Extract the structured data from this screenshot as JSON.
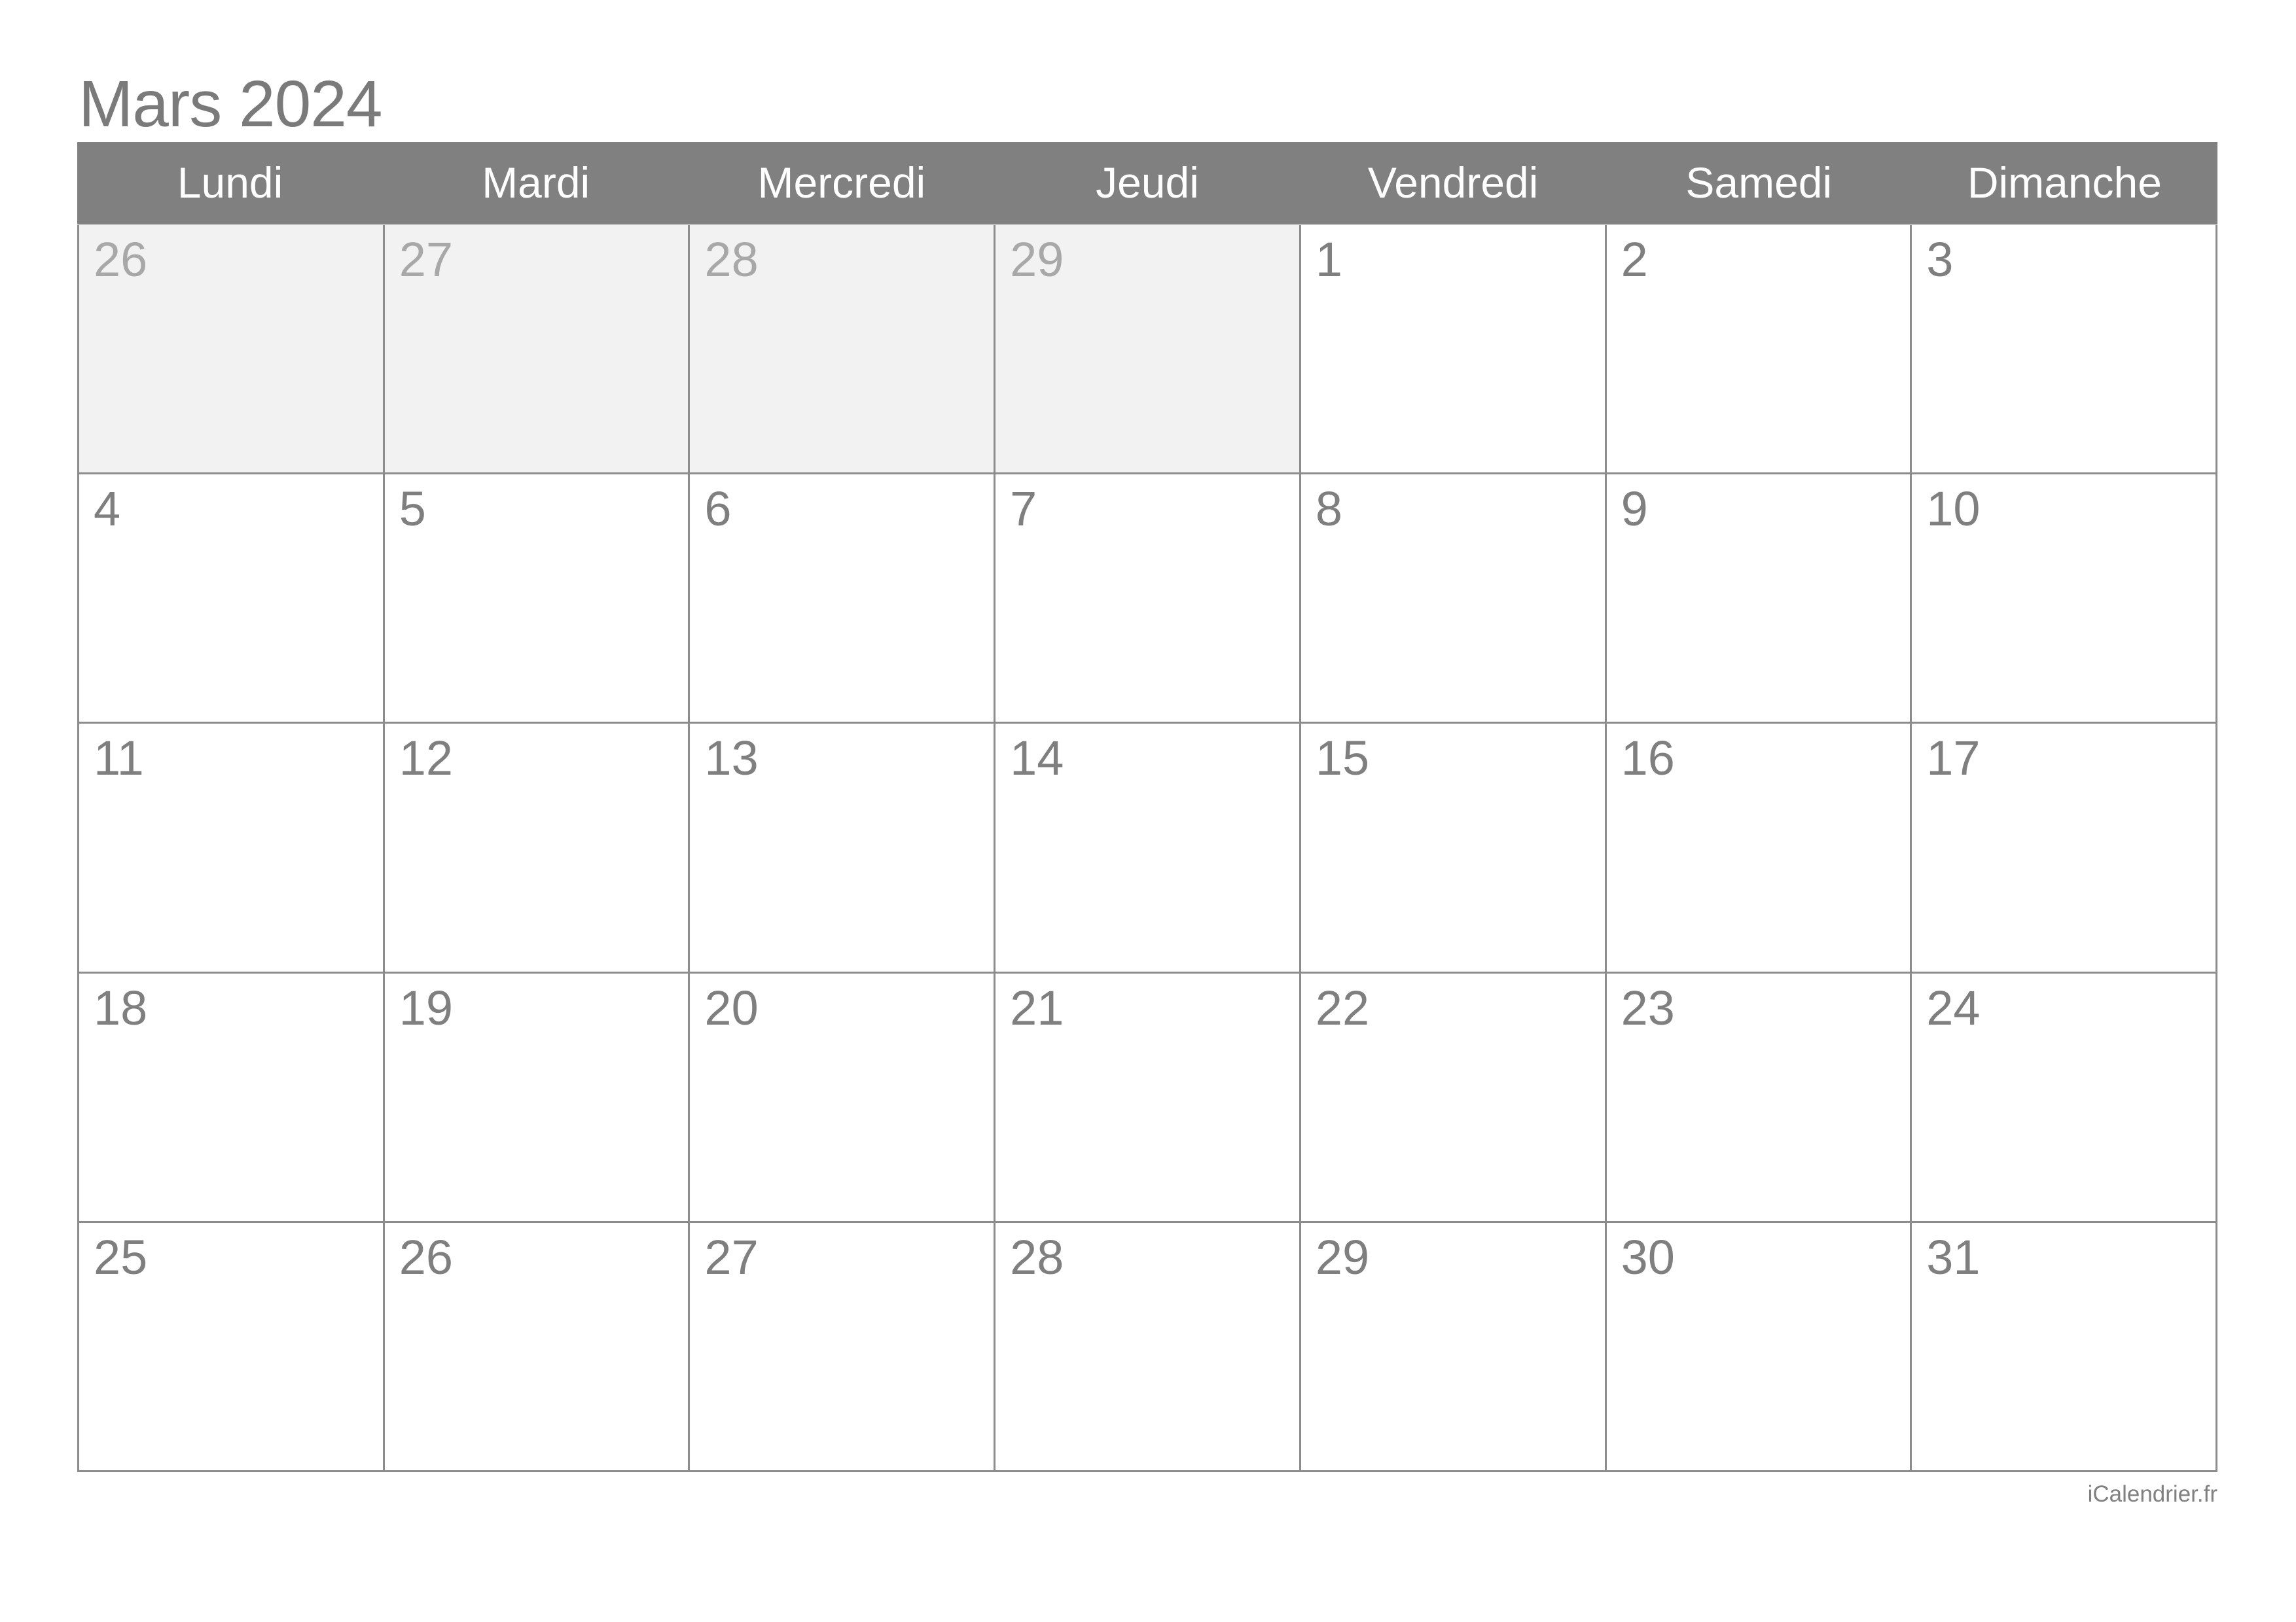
{
  "title": "Mars 2024",
  "weekdays": [
    "Lundi",
    "Mardi",
    "Mercredi",
    "Jeudi",
    "Vendredi",
    "Samedi",
    "Dimanche"
  ],
  "weeks": [
    [
      {
        "day": "26",
        "in_month": false
      },
      {
        "day": "27",
        "in_month": false
      },
      {
        "day": "28",
        "in_month": false
      },
      {
        "day": "29",
        "in_month": false
      },
      {
        "day": "1",
        "in_month": true
      },
      {
        "day": "2",
        "in_month": true
      },
      {
        "day": "3",
        "in_month": true
      }
    ],
    [
      {
        "day": "4",
        "in_month": true
      },
      {
        "day": "5",
        "in_month": true
      },
      {
        "day": "6",
        "in_month": true
      },
      {
        "day": "7",
        "in_month": true
      },
      {
        "day": "8",
        "in_month": true
      },
      {
        "day": "9",
        "in_month": true
      },
      {
        "day": "10",
        "in_month": true
      }
    ],
    [
      {
        "day": "11",
        "in_month": true
      },
      {
        "day": "12",
        "in_month": true
      },
      {
        "day": "13",
        "in_month": true
      },
      {
        "day": "14",
        "in_month": true
      },
      {
        "day": "15",
        "in_month": true
      },
      {
        "day": "16",
        "in_month": true
      },
      {
        "day": "17",
        "in_month": true
      }
    ],
    [
      {
        "day": "18",
        "in_month": true
      },
      {
        "day": "19",
        "in_month": true
      },
      {
        "day": "20",
        "in_month": true
      },
      {
        "day": "21",
        "in_month": true
      },
      {
        "day": "22",
        "in_month": true
      },
      {
        "day": "23",
        "in_month": true
      },
      {
        "day": "24",
        "in_month": true
      }
    ],
    [
      {
        "day": "25",
        "in_month": true
      },
      {
        "day": "26",
        "in_month": true
      },
      {
        "day": "27",
        "in_month": true
      },
      {
        "day": "28",
        "in_month": true
      },
      {
        "day": "29",
        "in_month": true
      },
      {
        "day": "30",
        "in_month": true
      },
      {
        "day": "31",
        "in_month": true
      }
    ]
  ],
  "footer": "iCalendrier.fr",
  "colors": {
    "header_bg": "#808080",
    "header_text": "#ffffff",
    "out_of_month_bg": "#f2f2f2",
    "out_of_month_text": "#a8a8a8",
    "day_text": "#7f7f7f",
    "border": "#8c8c8c",
    "title_text": "#7a7a7a"
  }
}
